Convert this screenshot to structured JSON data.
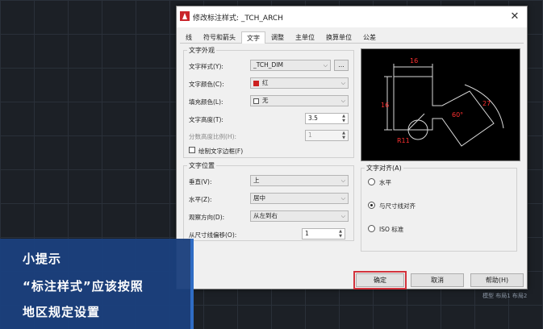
{
  "dialog": {
    "title": "修改标注样式: _TCH_ARCH",
    "close_glyph": "✕"
  },
  "tabs": [
    "线",
    "符号和箭头",
    "文字",
    "调整",
    "主单位",
    "换算单位",
    "公差"
  ],
  "active_tab": "文字",
  "text_appearance": {
    "group_title": "文字外观",
    "style_label": "文字样式(Y):",
    "style_value": "_TCH_DIM",
    "style_btn": "...",
    "color_label": "文字颜色(C):",
    "color_value": "红",
    "color_hex": "#cc2020",
    "fill_label": "填充颜色(L):",
    "fill_value": "无",
    "height_label": "文字高度(T):",
    "height_value": "3.5",
    "fraction_label": "分数高度比例(H):",
    "fraction_value": "1",
    "frame_label": "绘制文字边框(F)"
  },
  "text_placement": {
    "group_title": "文字位置",
    "vertical_label": "垂直(V):",
    "vertical_value": "上",
    "horizontal_label": "水平(Z):",
    "horizontal_value": "居中",
    "view_label": "观察方向(D):",
    "view_value": "从左到右",
    "offset_label": "从尺寸线偏移(O):",
    "offset_value": "1"
  },
  "text_alignment": {
    "group_title": "文字对齐(A)",
    "options": [
      "水平",
      "与尺寸线对齐",
      "ISO 标准"
    ],
    "selected": "与尺寸线对齐"
  },
  "preview": {
    "labels": [
      "16",
      "16",
      "27",
      "60°",
      "R11"
    ]
  },
  "buttons": {
    "ok": "确定",
    "cancel": "取消",
    "help": "帮助(H)"
  },
  "tip": {
    "line1": "小提示",
    "line2": "“标注样式”应该按照",
    "line3": "地区规定设置"
  },
  "watermark": "模型 布局1 布局2"
}
